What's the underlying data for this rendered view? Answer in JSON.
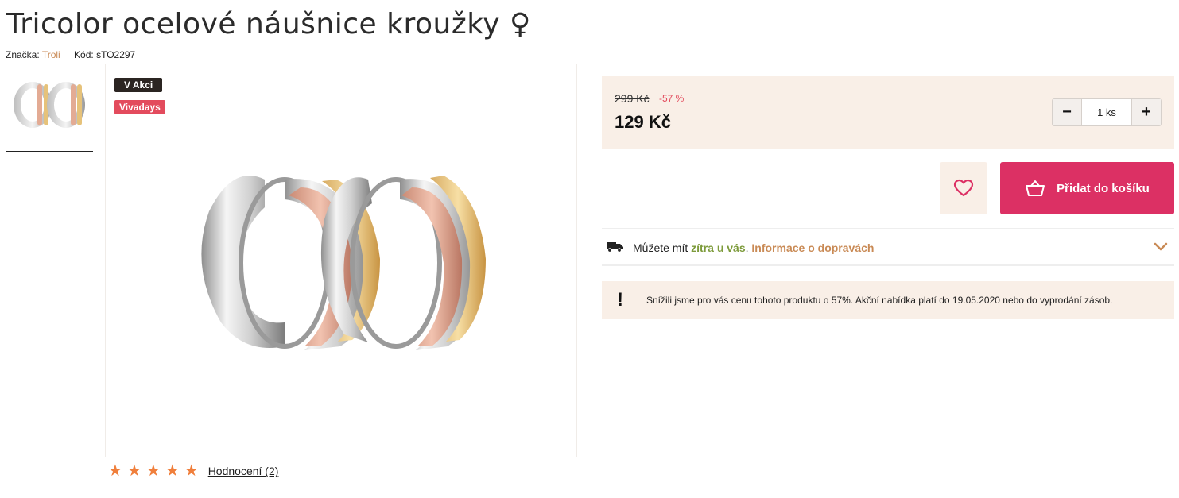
{
  "product": {
    "title": "Tricolor ocelové náušnice kroužky ♀",
    "brand_label": "Značka:",
    "brand": "Troli",
    "code_label": "Kód:",
    "code": "sTO2297"
  },
  "badges": {
    "sale": "V Akci",
    "promo": "Vivadays"
  },
  "rating": {
    "stars": 5,
    "link_text": "Hodnocení (2)"
  },
  "pricing": {
    "old_price": "299 Kč",
    "discount": "-57 %",
    "price": "129 Kč"
  },
  "quantity": {
    "minus": "−",
    "value": "1 ks",
    "plus": "+"
  },
  "cart": {
    "add_label": "Přidat do košíku"
  },
  "delivery": {
    "prefix": "Můžete mít ",
    "highlight": "zítra u vás",
    "separator": ". ",
    "info_link": "Informace o dopravách"
  },
  "notice": {
    "mark": "!",
    "text": "Snížili jsme pro vás cenu tohoto produktu o 57%. Akční nabídka platí do 19.05.2020 nebo do vyprodání zásob."
  },
  "colors": {
    "accent": "#dc3064",
    "brand_link": "#c98a55",
    "panel": "#f9efe7",
    "star": "#f07f3c",
    "discount": "#e34b5d"
  },
  "icons": {
    "wishlist": "heart-icon",
    "cart": "basket-icon",
    "delivery": "truck-icon",
    "expand": "chevron-down-icon",
    "rating": "star-icon"
  }
}
